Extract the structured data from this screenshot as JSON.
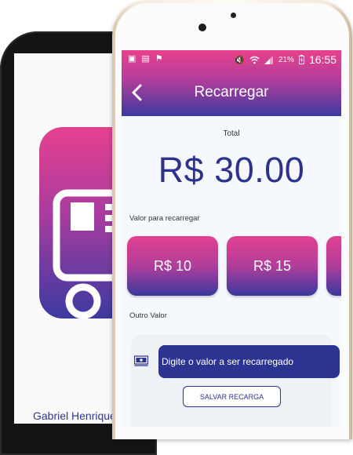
{
  "back_screen": {
    "user_name": "Gabriel Henrique"
  },
  "status_bar": {
    "battery_percent": "21%",
    "time": "16:55"
  },
  "header": {
    "title": "Recarregar"
  },
  "balance": {
    "label": "Total",
    "amount": "R$ 30.00"
  },
  "recharge": {
    "section_label": "Valor para recarregar",
    "options": [
      "R$ 10",
      "R$ 15"
    ]
  },
  "other_value": {
    "section_label": "Outro Valor",
    "placeholder": "Digite o valor a ser recarregado",
    "save_label": "SALVAR RECARGA"
  },
  "colors": {
    "pink": "#e8418c",
    "indigo": "#2d338c",
    "background": "#f5f9fe"
  },
  "icons": [
    "back-arrow-icon",
    "money-icon",
    "wifi-icon",
    "signal-icon",
    "battery-icon",
    "bus-card-icon"
  ]
}
